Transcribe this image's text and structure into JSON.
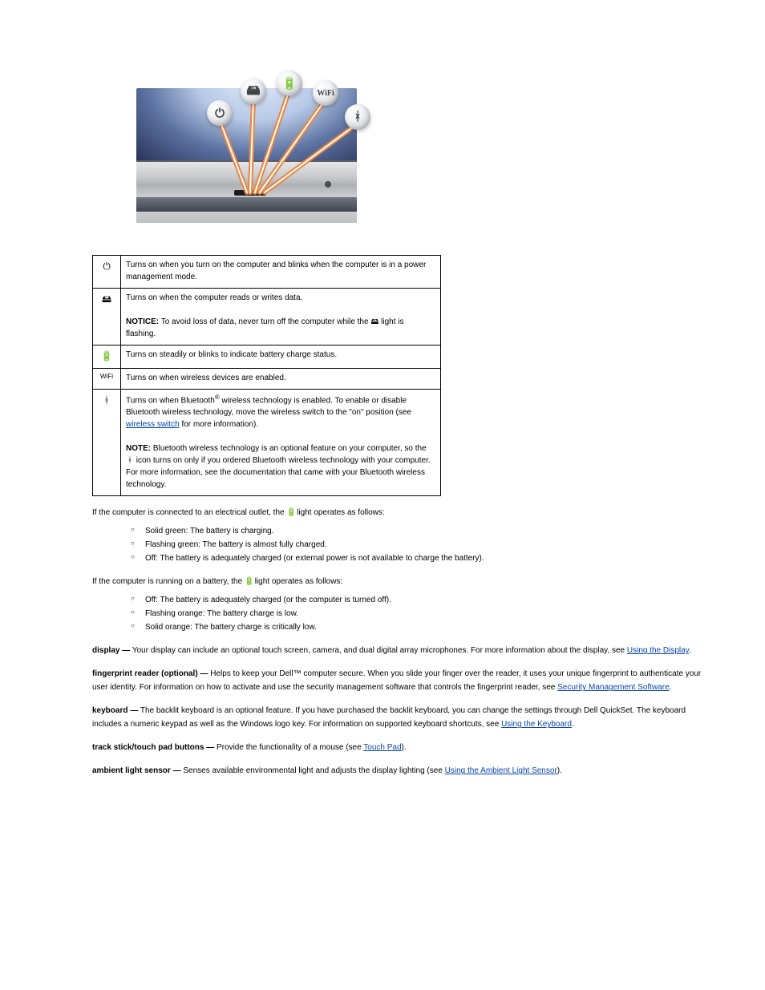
{
  "illus": {
    "alt": "Laptop hinge with five callout bubbles pointing to status LEDs",
    "icons": [
      "⏻",
      "🖴",
      "🔋",
      "wifi",
      "ᚼ"
    ]
  },
  "table": {
    "rows": [
      {
        "icon": "⏻",
        "text": "Turns on when you turn on the computer and blinks when the computer is in a power management mode."
      },
      {
        "icon": "🖴",
        "text_a": "Turns on when the computer reads or writes data.",
        "notice_label": "NOTICE:",
        "notice_text": " To avoid loss of data, never turn off the computer while the ",
        "notice_tail": " light is flashing.",
        "inline_icon": "🖴"
      },
      {
        "icon": "🔋",
        "text": "Turns on steadily or blinks to indicate battery charge status."
      },
      {
        "icon": "wifi",
        "text": "Turns on when wireless devices are enabled."
      },
      {
        "icon": "ᚼ",
        "text_a": "Turns on when Bluetooth",
        "text_b": " wireless technology is enabled. To enable or disable Bluetooth wireless technology, move the wireless switch to the \"on\" position (see ",
        "link": "wireless switch",
        "text_c": " for more information).",
        "note_label": "NOTE:",
        "note_text": " Bluetooth wireless technology is an optional feature on your computer, so the ",
        "note_tail": " icon turns on only if you ordered Bluetooth wireless technology with your computer. For more information, see the documentation that came with your Bluetooth wireless technology.",
        "inline_icon": "ᚼ"
      }
    ]
  },
  "ac_intro": "If the computer is connected to an electrical outlet, the ",
  "ac_icon": "🔋",
  "ac_tail": " light operates as follows:",
  "ac_list": [
    "Solid green: The battery is charging.",
    "Flashing green: The battery is almost fully charged.",
    "Off: The battery is adequately charged (or external power is not available to charge the battery)."
  ],
  "bat_intro": "If the computer is running on a battery, the ",
  "bat_icon": "🔋",
  "bat_tail": " light operates as follows:",
  "bat_list": [
    "Off: The battery is adequately charged (or the computer is turned off).",
    "Flashing orange: The battery charge is low.",
    "Solid orange: The battery charge is critically low."
  ],
  "display": {
    "term": "display ",
    "dash": "—",
    "text": " Your display can include an optional touch screen, camera, and dual digital array microphones. For more information about the display, see ",
    "link": "Using the Display",
    "tail": "."
  },
  "fingerprint": {
    "term": "fingerprint reader (optional) ",
    "dash": "—",
    "text": " Helps to keep your Dell™ computer secure. When you slide your finger over the reader, it uses your unique fingerprint to authenticate your user identity. For information on how to activate and use the security management software that controls the fingerprint reader, see ",
    "link": "Security Management Software",
    "tail": "."
  },
  "keyboard": {
    "term": "keyboard ",
    "dash": "—",
    "text": " The backlit keyboard is an optional feature. If you have purchased the backlit keyboard, you can change the settings through Dell QuickSet. The keyboard includes a numeric keypad as well as the Windows logo key. For information on supported keyboard shortcuts, see ",
    "link": "Using the Keyboard",
    "tail": "."
  },
  "trackstick": {
    "term": "track stick/touch pad buttons ",
    "dash": "—",
    "text": " Provide the functionality of a mouse (see ",
    "link": "Touch Pad",
    "tail": ")."
  },
  "ambient": {
    "term": "ambient light sensor ",
    "dash": "—",
    "text": " Senses available environmental light and adjusts the display lighting (see ",
    "link": "Using the Ambient Light Sensor",
    "tail": ")."
  }
}
